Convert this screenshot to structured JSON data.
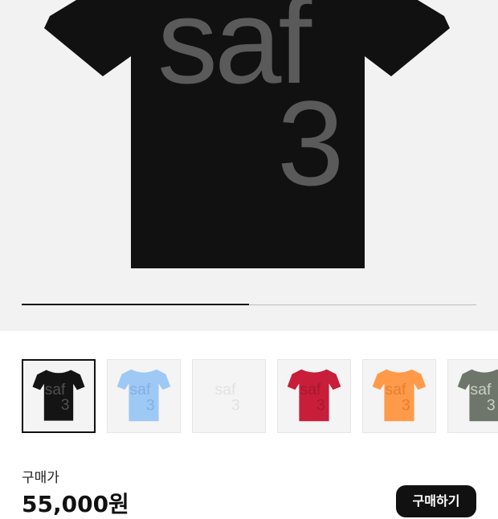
{
  "product": {
    "print_text_top": "saf",
    "print_text_bottom": "3",
    "image_color": "#111111",
    "print_color": "#5a5a5a"
  },
  "gallery": {
    "progress": 0.5
  },
  "thumbnails": [
    {
      "name": "black",
      "shirt": "#141414",
      "print": "#505050",
      "selected": true
    },
    {
      "name": "light-blue",
      "shirt": "#9ec9f5",
      "print": "#7fb0e6",
      "selected": false
    },
    {
      "name": "white",
      "shirt": "#f4f4f4",
      "print": "#e2e2e2",
      "selected": false
    },
    {
      "name": "red",
      "shirt": "#c81e3a",
      "print": "#a8182f",
      "selected": false
    },
    {
      "name": "orange",
      "shirt": "#ff9a4a",
      "print": "#e57f33",
      "selected": false
    },
    {
      "name": "olive",
      "shirt": "#6e756b",
      "print": "#c9cfc6",
      "selected": false
    }
  ],
  "purchase": {
    "price_label": "구매가",
    "price_value": "55,000원",
    "buy_button": "구매하기"
  }
}
